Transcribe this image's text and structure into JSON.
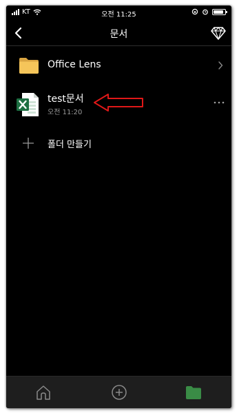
{
  "status_bar": {
    "carrier": "KT",
    "time": "오전 11:25",
    "battery_level": 0.85
  },
  "nav": {
    "title": "문서",
    "back_icon": "chevron-left-icon",
    "premium_icon": "diamond-icon"
  },
  "folders": [
    {
      "name": "Office Lens",
      "icon": "folder-icon"
    }
  ],
  "files": [
    {
      "name": "test문서",
      "modified": "오전 11:20",
      "icon": "excel-icon"
    }
  ],
  "actions": {
    "create_folder": "폴더 만들기"
  },
  "tab_bar": {
    "tabs": [
      {
        "name": "home",
        "icon": "home-icon"
      },
      {
        "name": "create",
        "icon": "plus-circle-icon"
      },
      {
        "name": "files",
        "icon": "folder-filled-icon",
        "active": true
      }
    ]
  },
  "colors": {
    "background": "#000000",
    "folder": "#f5c55a",
    "excel_green": "#1d6f42",
    "active_tab": "#3a8c46",
    "annotation_arrow": "#e01818"
  }
}
